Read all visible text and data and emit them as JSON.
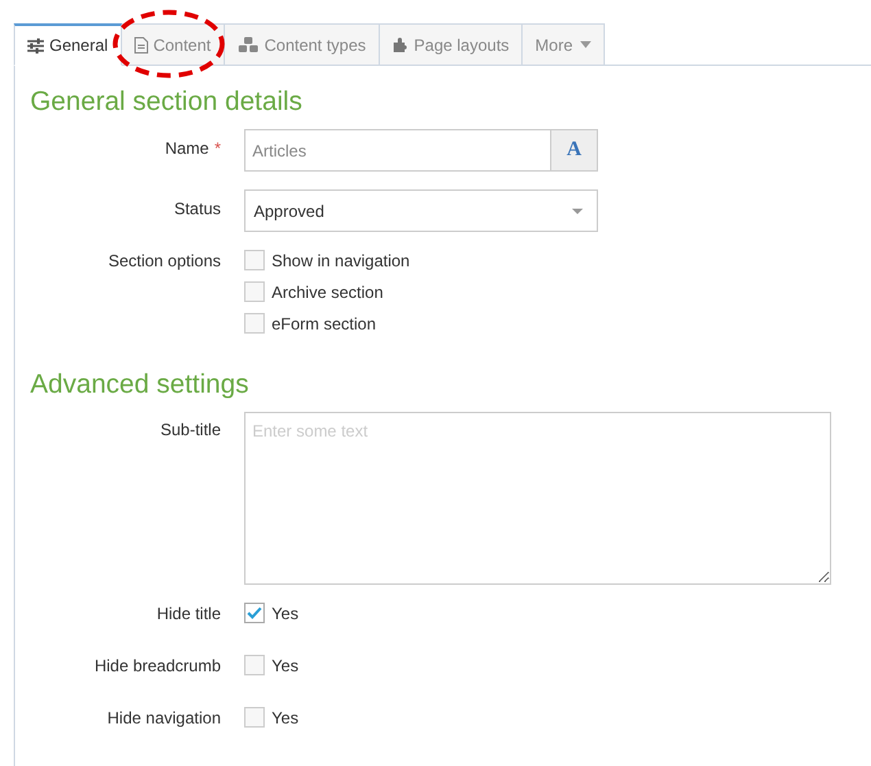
{
  "tabs": [
    {
      "label": "General",
      "selected": true,
      "circled": false
    },
    {
      "label": "Content",
      "selected": false,
      "circled": true
    },
    {
      "label": "Content types",
      "selected": false,
      "circled": false
    },
    {
      "label": "Page layouts",
      "selected": false,
      "circled": false
    },
    {
      "label": "More",
      "selected": false,
      "circled": false
    }
  ],
  "sections": [
    {
      "heading": "General section details",
      "fields": [
        {
          "kind": "text",
          "label": "Name",
          "required_mark": "*",
          "placeholder": "Articles",
          "addon": "A"
        },
        {
          "kind": "select",
          "label": "Status",
          "value": "Approved"
        },
        {
          "kind": "checkboxes",
          "label": "Section options",
          "options": [
            {
              "label": "Show in navigation",
              "checked": false
            },
            {
              "label": "Archive section",
              "checked": false
            },
            {
              "label": "eForm section",
              "checked": false
            }
          ]
        }
      ]
    },
    {
      "heading": "Advanced settings",
      "fields": [
        {
          "kind": "textarea",
          "label": "Sub-title",
          "placeholder": "Enter some text"
        },
        {
          "kind": "checkbox",
          "label": "Hide title",
          "options": [
            {
              "label": "Yes",
              "checked": true
            }
          ]
        },
        {
          "kind": "checkbox",
          "label": "Hide breadcrumb",
          "options": [
            {
              "label": "Yes",
              "checked": false
            }
          ]
        },
        {
          "kind": "checkbox",
          "label": "Hide navigation",
          "options": [
            {
              "label": "Yes",
              "checked": false
            }
          ]
        }
      ]
    }
  ]
}
